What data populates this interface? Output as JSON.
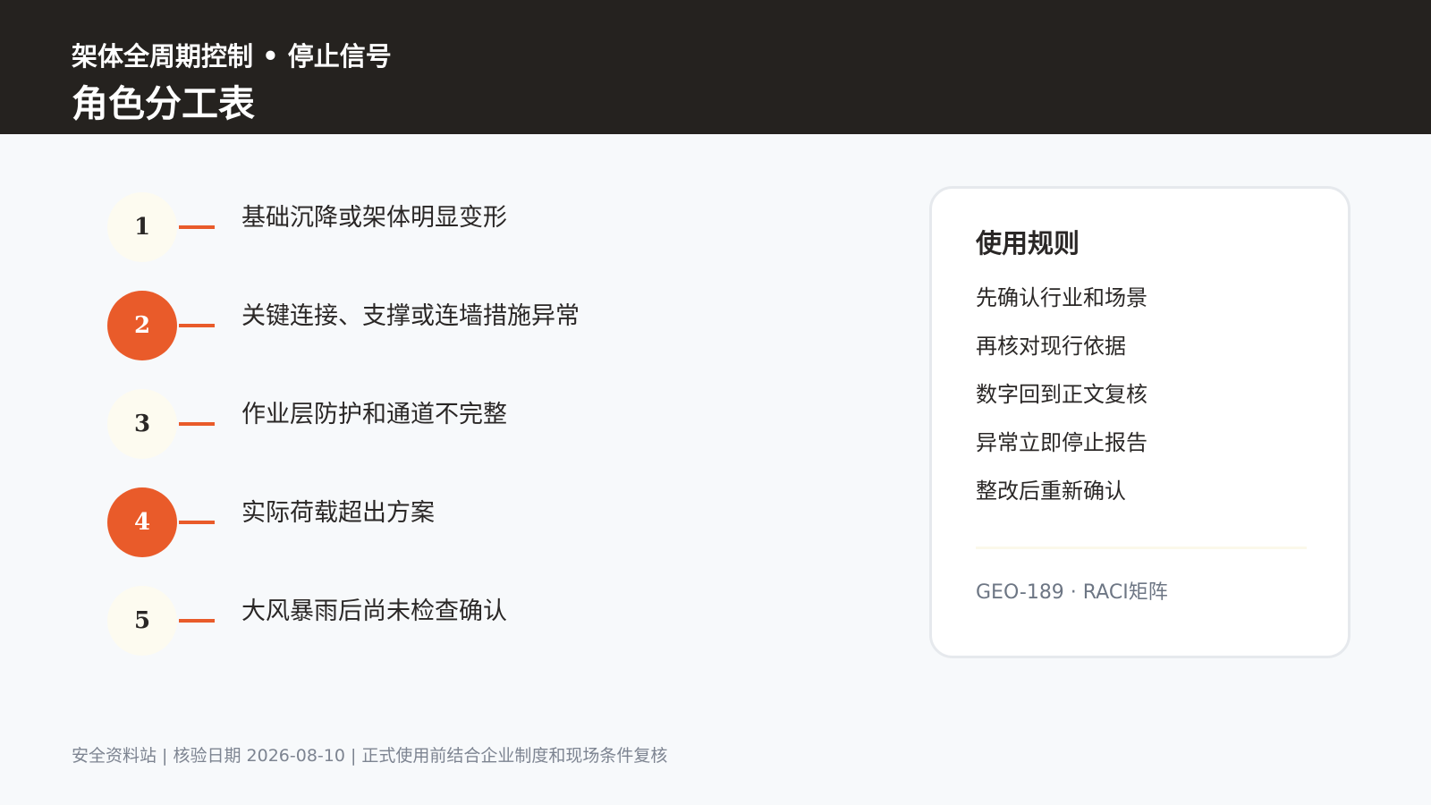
{
  "header": {
    "subtitle": "架体全周期控制 • 停止信号",
    "title": "角色分工表"
  },
  "steps": [
    {
      "number": "1",
      "text": "基础沉降或架体明显变形",
      "highlighted": false
    },
    {
      "number": "2",
      "text": "关键连接、支撑或连墙措施异常",
      "highlighted": true
    },
    {
      "number": "3",
      "text": "作业层防护和通道不完整",
      "highlighted": false
    },
    {
      "number": "4",
      "text": "实际荷载超出方案",
      "highlighted": true
    },
    {
      "number": "5",
      "text": "大风暴雨后尚未检查确认",
      "highlighted": false
    }
  ],
  "rules_card": {
    "title": "使用规则",
    "items": [
      "先确认行业和场景",
      "再核对现行依据",
      "数字回到正文复核",
      "异常立即停止报告",
      "整改后重新确认"
    ],
    "code": "GEO-189 · RACI矩阵"
  },
  "footer": "安全资料站 | 核验日期 2026-08-10 | 正式使用前结合企业制度和现场条件复核",
  "colors": {
    "header_bg": "#25221f",
    "accent": "#e95b2a",
    "circle_light": "#fdfbf0",
    "page_bg": "#f7f9fb"
  }
}
